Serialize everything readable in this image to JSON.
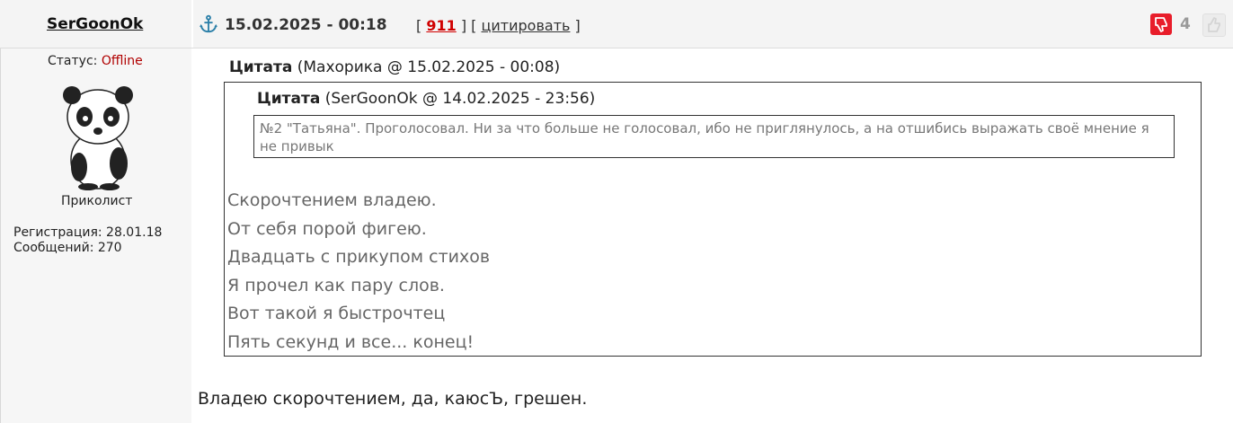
{
  "header": {
    "author": "SerGoonOk",
    "date": "15.02.2025 - 00:18",
    "bracket_open": "[",
    "post_number": "911",
    "separator": "] [",
    "quote_label": "цитировать",
    "bracket_close": "]",
    "rating": "4",
    "icons": {
      "anchor": "anchor-icon",
      "dislike": "thumbs-down-icon",
      "like": "thumbs-up-icon"
    },
    "colors": {
      "dislike_bg": "#e81d2a",
      "post_number": "#d00000",
      "anchor": "#2a7fa8"
    }
  },
  "sidebar": {
    "status_label": "Статус:",
    "status_value": "Offline",
    "rank": "Приколист",
    "registration": "Регистрация: 28.01.18",
    "messages": "Сообщений: 270"
  },
  "post": {
    "quote1": {
      "label": "Цитата",
      "meta": "(Махорика @ 15.02.2025 - 00:08)"
    },
    "quote2": {
      "label": "Цитата",
      "meta": "(SerGoonOk @ 14.02.2025 - 23:56)",
      "text": "№2 \"Татьяна\". Проголосовал. Ни за что больше не голосовал, ибо не приглянулось, а на отшибись выражать своё мнение я не привык"
    },
    "poem": [
      "Скорочтением владею.",
      "От себя порой фигею.",
      "Двадцать с прикупом стихов",
      "Я прочел как пару слов.",
      "Вот такой я быстрочтец",
      "Пять секунд и все... конец!"
    ],
    "reply": "Владею скорочтением, да, каюсЪ, грешен."
  }
}
